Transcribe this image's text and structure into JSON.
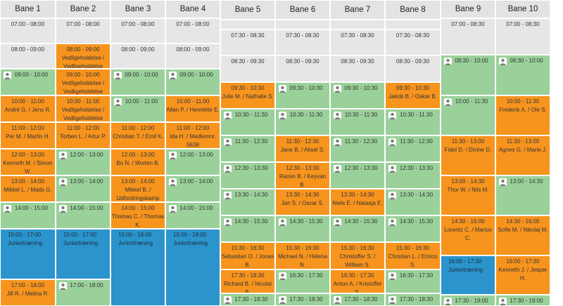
{
  "courts": [
    {
      "label": "Bane 1"
    },
    {
      "label": "Bane 2"
    },
    {
      "label": "Bane 3"
    },
    {
      "label": "Bane 4"
    },
    {
      "label": "Bane 5"
    },
    {
      "label": "Bane 6"
    },
    {
      "label": "Bane 7"
    },
    {
      "label": "Bane 8"
    },
    {
      "label": "Bane 9"
    },
    {
      "label": "Bane 10"
    }
  ],
  "slots": {
    "c1": [
      {
        "time": "07:00 - 08:00",
        "name": "",
        "type": "free"
      },
      {
        "time": "08:00 - 09:00",
        "name": "",
        "type": "free"
      },
      {
        "time": "09:00 - 10:00",
        "name": "",
        "type": "open"
      },
      {
        "time": "10:00 - 11:00",
        "name": "André G. / Jens R.",
        "type": "booked"
      },
      {
        "time": "11:00 - 12:00",
        "name": "Per M. / Martin H.",
        "type": "booked"
      },
      {
        "time": "12:00 - 13:00",
        "name": "Kenneth M. / Simon W.",
        "type": "booked"
      },
      {
        "time": "13:00 - 14:00",
        "name": "Mikkel L. / Mads G.",
        "type": "booked"
      },
      {
        "time": "14:00 - 15:00",
        "name": "",
        "type": "open"
      },
      {
        "time": "15:00 - 17:00",
        "name": "Juniortræning",
        "type": "training"
      },
      {
        "time": "17:00 - 18:00",
        "name": "Jill R. / Melina R.",
        "type": "booked"
      }
    ],
    "c2": [
      {
        "time": "07:00 - 08:00",
        "name": "",
        "type": "free"
      },
      {
        "time": "08:00 - 09:00",
        "name": "Vedligeholdelse / Vedligeholdelse",
        "type": "booked"
      },
      {
        "time": "09:00 - 10:00",
        "name": "Vedligeholdelse / Vedligeholdelse",
        "type": "booked"
      },
      {
        "time": "10:00 - 11:00",
        "name": "Vedligeholdelse / Vedligeholdelse",
        "type": "booked"
      },
      {
        "time": "11:00 - 12:00",
        "name": "Torben L. / Artur P.",
        "type": "booked"
      },
      {
        "time": "12:00 - 13:00",
        "name": "",
        "type": "open"
      },
      {
        "time": "13:00 - 14:00",
        "name": "",
        "type": "open"
      },
      {
        "time": "14:00 - 15:00",
        "name": "",
        "type": "open"
      },
      {
        "time": "15:00 - 17:00",
        "name": "Juniortræning",
        "type": "training"
      },
      {
        "time": "17:00 - 18:00",
        "name": "",
        "type": "open"
      }
    ],
    "c3": [
      {
        "time": "07:00 - 08:00",
        "name": "",
        "type": "free"
      },
      {
        "time": "08:00 - 09:00",
        "name": "",
        "type": "free"
      },
      {
        "time": "09:00 - 10:00",
        "name": "",
        "type": "open"
      },
      {
        "time": "10:00 - 11:00",
        "name": "",
        "type": "open"
      },
      {
        "time": "11:00 - 12:00",
        "name": "Christian T. / Emil K.",
        "type": "booked"
      },
      {
        "time": "12:00 - 13:00",
        "name": "Bo N. / Morten B.",
        "type": "booked"
      },
      {
        "time": "13:00 - 14:00",
        "name": "Mikkel B. / Udfordringskamp",
        "type": "booked"
      },
      {
        "time": "14:00 - 15:00",
        "name": "Thomas C. / Thomas K.",
        "type": "booked"
      },
      {
        "time": "15:00 - 18:00",
        "name": "Juniortræning",
        "type": "training"
      }
    ],
    "c4": [
      {
        "time": "07:00 - 08:00",
        "name": "",
        "type": "free"
      },
      {
        "time": "08:00 - 09:00",
        "name": "",
        "type": "free"
      },
      {
        "time": "09:00 - 10:00",
        "name": "",
        "type": "open"
      },
      {
        "time": "10:00 - 11:00",
        "name": "Allan P. / Henriette E.",
        "type": "booked"
      },
      {
        "time": "11:00 - 12:00",
        "name": "Ida H. / Medlemnr. 5638",
        "type": "booked"
      },
      {
        "time": "12:00 - 13:00",
        "name": "",
        "type": "open"
      },
      {
        "time": "13:00 - 14:00",
        "name": "",
        "type": "open"
      },
      {
        "time": "14:00 - 15:00",
        "name": "",
        "type": "open"
      },
      {
        "time": "15:00 - 18:00",
        "name": "Juniortræning",
        "type": "training"
      }
    ],
    "c5": [
      {
        "time": "",
        "name": "",
        "type": "free"
      },
      {
        "time": "07:30 - 08:30",
        "name": "",
        "type": "free"
      },
      {
        "time": "08:30 - 09:30",
        "name": "",
        "type": "free"
      },
      {
        "time": "09:30 - 10:30",
        "name": "Julie M. / Nathalie S.",
        "type": "booked"
      },
      {
        "time": "10:30 - 11:30",
        "name": "",
        "type": "open"
      },
      {
        "time": "11:30 - 12:30",
        "name": "",
        "type": "open"
      },
      {
        "time": "12:30 - 13:30",
        "name": "",
        "type": "open"
      },
      {
        "time": "13:30 - 14:30",
        "name": "",
        "type": "open"
      },
      {
        "time": "14:30 - 15:30",
        "name": "",
        "type": "open"
      },
      {
        "time": "15:30 - 16:30",
        "name": "Sebastian O. / Jonas B.",
        "type": "booked"
      },
      {
        "time": "17:30 - 18:30",
        "name": "Richard B. / Nicolai B.",
        "type": "booked"
      },
      {
        "time": "17:30 - 18:30",
        "name": "",
        "type": "open"
      }
    ],
    "c6": [
      {
        "time": "",
        "name": "",
        "type": "free"
      },
      {
        "time": "07:30 - 08:30",
        "name": "",
        "type": "free"
      },
      {
        "time": "08:30 - 09:30",
        "name": "",
        "type": "free"
      },
      {
        "time": "09:30 - 10:30",
        "name": "",
        "type": "open"
      },
      {
        "time": "10:30 - 11:30",
        "name": "",
        "type": "open"
      },
      {
        "time": "11:30 - 12:30",
        "name": "Jane B. / Aksel S.",
        "type": "booked"
      },
      {
        "time": "12:30 - 13:30",
        "name": "Ramin B. / Keyvan B.",
        "type": "booked"
      },
      {
        "time": "13:30 - 14:30",
        "name": "Jan S. / Oscar S.",
        "type": "booked"
      },
      {
        "time": "14:30 - 15:30",
        "name": "",
        "type": "open"
      },
      {
        "time": "15:30 - 16:30",
        "name": "Michael N. / Helena N.",
        "type": "booked"
      },
      {
        "time": "16:30 - 17:30",
        "name": "",
        "type": "open"
      },
      {
        "time": "17:30 - 18:30",
        "name": "",
        "type": "open"
      }
    ],
    "c7": [
      {
        "time": "",
        "name": "",
        "type": "free"
      },
      {
        "time": "07:30 - 08:30",
        "name": "",
        "type": "free"
      },
      {
        "time": "08:30 - 09:30",
        "name": "",
        "type": "free"
      },
      {
        "time": "09:30 - 10:30",
        "name": "",
        "type": "open"
      },
      {
        "time": "10:30 - 11:30",
        "name": "",
        "type": "open"
      },
      {
        "time": "11:30 - 12:30",
        "name": "",
        "type": "open"
      },
      {
        "time": "12:30 - 13:30",
        "name": "",
        "type": "open"
      },
      {
        "time": "13:30 - 14:30",
        "name": "Niels E. / Natasja E.",
        "type": "booked"
      },
      {
        "time": "14:30 - 15:30",
        "name": "",
        "type": "open"
      },
      {
        "time": "15:30 - 16:30",
        "name": "Christoffer S. / William S.",
        "type": "booked"
      },
      {
        "time": "16:30 - 17:30",
        "name": "Anton A. / Kristoffer S.",
        "type": "booked"
      },
      {
        "time": "17:30 - 18:30",
        "name": "",
        "type": "open"
      }
    ],
    "c8": [
      {
        "time": "",
        "name": "",
        "type": "free"
      },
      {
        "time": "07:30 - 08:30",
        "name": "",
        "type": "free"
      },
      {
        "time": "08:30 - 09:30",
        "name": "",
        "type": "free"
      },
      {
        "time": "09:30 - 10:30",
        "name": "Jakob B. / Oskar B.",
        "type": "booked"
      },
      {
        "time": "10:30 - 11:30",
        "name": "",
        "type": "open"
      },
      {
        "time": "11:30 - 12:30",
        "name": "",
        "type": "open"
      },
      {
        "time": "12:30 - 13:30",
        "name": "",
        "type": "open"
      },
      {
        "time": "13:30 - 14:30",
        "name": "",
        "type": "open"
      },
      {
        "time": "14:30 - 15:30",
        "name": "",
        "type": "open"
      },
      {
        "time": "15:30 - 16:30",
        "name": "Christian L. / Enrico S.",
        "type": "booked"
      },
      {
        "time": "16:30 - 17:30",
        "name": "",
        "type": "open"
      },
      {
        "time": "17:30 - 18:30",
        "name": "",
        "type": "open"
      }
    ],
    "c9": [
      {
        "time": "07:00 - 08:30",
        "name": "",
        "type": "free"
      },
      {
        "time": "08:30 - 10:00",
        "name": "",
        "type": "open"
      },
      {
        "time": "10:00 - 11:30",
        "name": "",
        "type": "open"
      },
      {
        "time": "11:30 - 13:00",
        "name": "Fidel D. / Divine D.",
        "type": "booked"
      },
      {
        "time": "13:00 - 14:30",
        "name": "Thor W. / Nils M.",
        "type": "booked"
      },
      {
        "time": "14:30 - 16:00",
        "name": "Lorentz C. / Marius C.",
        "type": "booked"
      },
      {
        "time": "16:00 - 17:30",
        "name": "Juniortræning",
        "type": "training"
      },
      {
        "time": "17:30 - 19:00",
        "name": "",
        "type": "open"
      }
    ],
    "c10": [
      {
        "time": "07:00 - 08:30",
        "name": "",
        "type": "free"
      },
      {
        "time": "08:30 - 10:00",
        "name": "",
        "type": "open"
      },
      {
        "time": "10:00 - 11:30",
        "name": "Fredenk A. / Ole S.",
        "type": "booked"
      },
      {
        "time": "11:30 - 13:00",
        "name": "Agnes G. / Marie J.",
        "type": "booked"
      },
      {
        "time": "13:00 - 14:30",
        "name": "",
        "type": "open"
      },
      {
        "time": "14:30 - 16:00",
        "name": "Sofie M. / Nikolaj M.",
        "type": "booked"
      },
      {
        "time": "16:00 - 17:30",
        "name": "Kenneth J. / Jesper H.",
        "type": "booked"
      },
      {
        "time": "17:30 - 19:00",
        "name": "",
        "type": "open"
      }
    ]
  },
  "colors": {
    "free": "#e6e6e6",
    "booked": "#f7941e",
    "open": "#9ad19a",
    "training": "#2b94cc"
  }
}
